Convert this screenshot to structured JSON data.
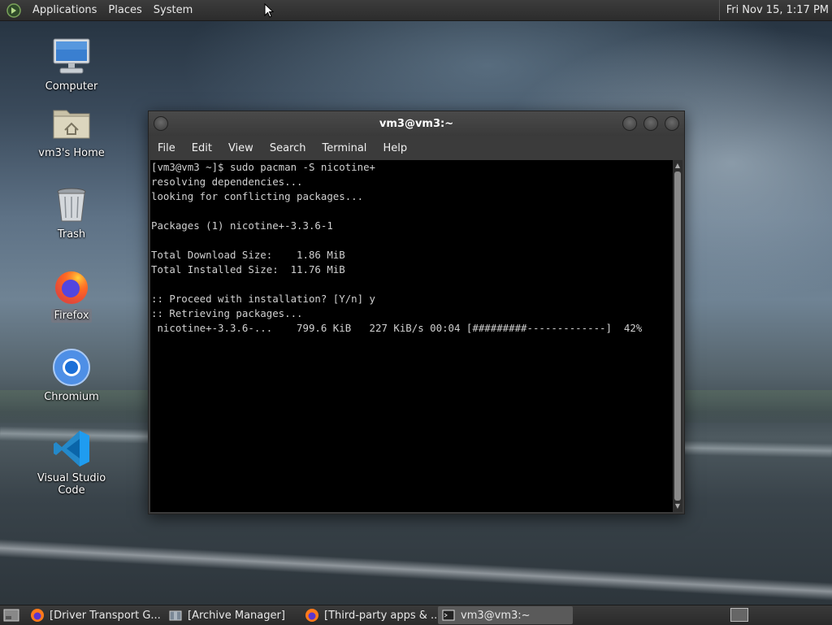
{
  "top_panel": {
    "menus": [
      "Applications",
      "Places",
      "System"
    ],
    "clock": "Fri Nov 15,  1:17 PM"
  },
  "desktop_icons": [
    {
      "label": "Computer",
      "icon": "computer-icon"
    },
    {
      "label": "vm3's Home",
      "icon": "home-folder-icon"
    },
    {
      "label": "Trash",
      "icon": "trash-icon"
    },
    {
      "label": "Firefox",
      "icon": "firefox-icon",
      "selected": true
    },
    {
      "label": "Chromium",
      "icon": "chromium-icon"
    },
    {
      "label": "Visual Studio Code",
      "icon": "vscode-icon"
    }
  ],
  "terminal": {
    "title": "vm3@vm3:~",
    "menus": [
      "File",
      "Edit",
      "View",
      "Search",
      "Terminal",
      "Help"
    ],
    "lines": [
      "[vm3@vm3 ~]$ sudo pacman -S nicotine+",
      "resolving dependencies...",
      "looking for conflicting packages...",
      "",
      "Packages (1) nicotine+-3.3.6-1",
      "",
      "Total Download Size:    1.86 MiB",
      "Total Installed Size:  11.76 MiB",
      "",
      ":: Proceed with installation? [Y/n] y",
      ":: Retrieving packages...",
      " nicotine+-3.3.6-...    799.6 KiB   227 KiB/s 00:04 [#########-------------]  42%"
    ]
  },
  "taskbar": {
    "tasks": [
      {
        "label": "[Driver Transport G...",
        "icon": "firefox-icon",
        "active": false
      },
      {
        "label": "[Archive Manager]",
        "icon": "archive-manager-icon",
        "active": false
      },
      {
        "label": "[Third-party apps & ...",
        "icon": "firefox-icon",
        "active": false
      },
      {
        "label": "vm3@vm3:~",
        "icon": "terminal-icon",
        "active": true
      }
    ]
  }
}
